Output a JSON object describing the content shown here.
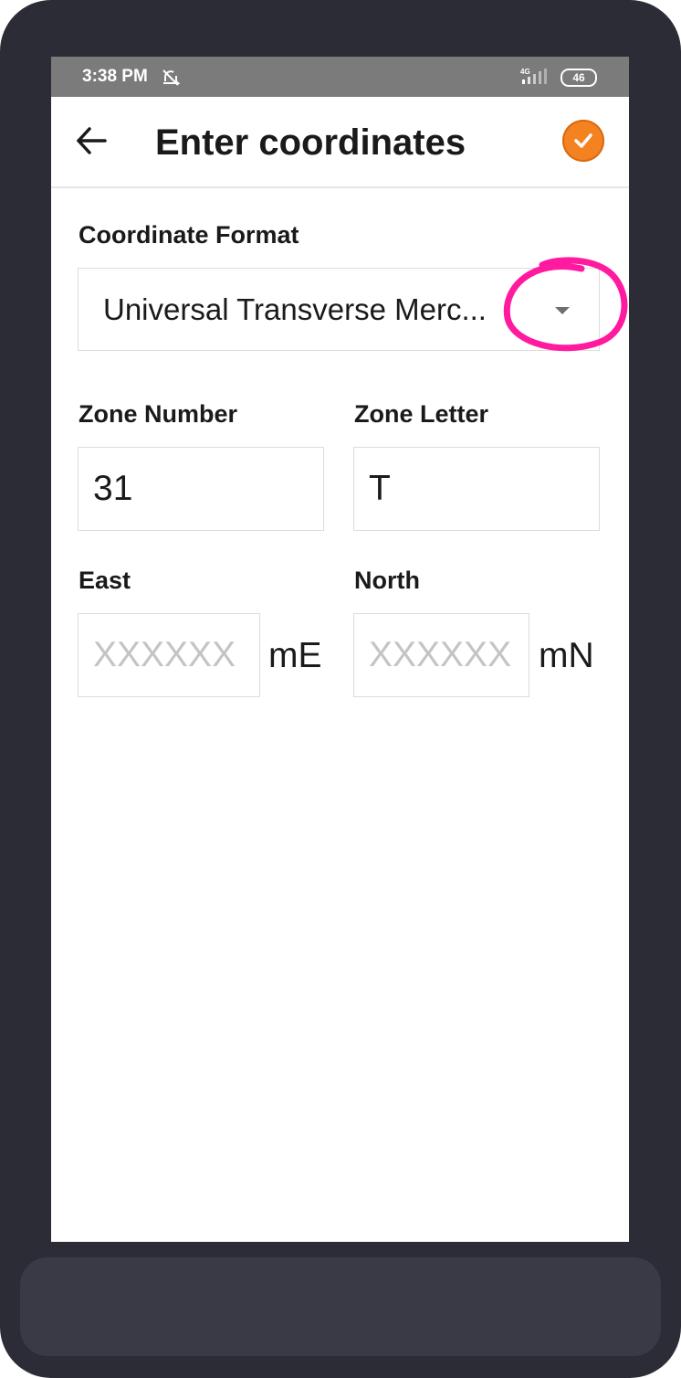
{
  "status_bar": {
    "time": "3:38 PM",
    "network": "4G",
    "battery": "46",
    "icons": [
      "notifications-off-icon",
      "signal-icon",
      "battery-icon"
    ]
  },
  "app_bar": {
    "title": "Enter coordinates",
    "back_icon": "arrow-left-icon",
    "confirm_icon": "checkmark-circle-icon",
    "accent_color": "#f58220"
  },
  "form": {
    "format_label": "Coordinate Format",
    "format_value": "Universal Transverse Merc...",
    "zone_number": {
      "label": "Zone Number",
      "value": "31"
    },
    "zone_letter": {
      "label": "Zone Letter",
      "value": "T"
    },
    "east": {
      "label": "East",
      "placeholder": "XXXXXX",
      "value": "",
      "unit": "mE"
    },
    "north": {
      "label": "North",
      "placeholder": "XXXXXX",
      "value": "",
      "unit": "mN"
    }
  },
  "annotation": {
    "color": "#ff1aa0",
    "shape": "hand-drawn-circle"
  }
}
